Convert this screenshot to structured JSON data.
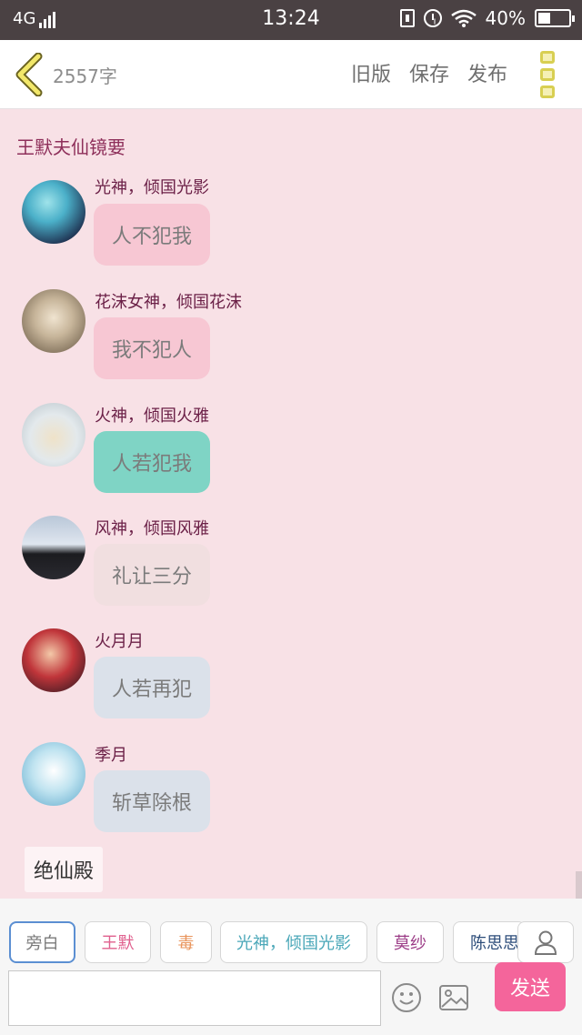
{
  "status_bar": {
    "network": "4G",
    "time": "13:24",
    "battery_text": "40%",
    "battery_level": 0.4
  },
  "header": {
    "word_count": "2557字",
    "old_version": "旧版",
    "save": "保存",
    "publish": "发布"
  },
  "chapter_title": "王默夫仙镜要",
  "messages": [
    {
      "sender": "光神，倾国光影",
      "text": "人不犯我",
      "bubble_color": "#f7c7d3"
    },
    {
      "sender": "花沫女神，倾国花沫",
      "text": "我不犯人",
      "bubble_color": "#f7c7d3"
    },
    {
      "sender": "火神，倾国火雅",
      "text": "人若犯我",
      "bubble_color": "#7fd4c5"
    },
    {
      "sender": "风神，倾国风雅",
      "text": "礼让三分",
      "bubble_color": "#f1dfe0"
    },
    {
      "sender": "火月月",
      "text": "人若再犯",
      "bubble_color": "#dbe1ea"
    },
    {
      "sender": "季月",
      "text": "斩草除根",
      "bubble_color": "#dbe1ea"
    }
  ],
  "narration": "绝仙殿",
  "roles": [
    {
      "label": "旁白",
      "color": "#7a7a7a"
    },
    {
      "label": "王默",
      "color": "#e0608e"
    },
    {
      "label": "毒",
      "color": "#e8935a"
    },
    {
      "label": "光神，倾国光影",
      "color": "#4aa7b8"
    },
    {
      "label": "莫纱",
      "color": "#9b3b86"
    },
    {
      "label": "陈思思",
      "color": "#2d4d7a"
    }
  ],
  "input": {
    "value": "",
    "placeholder": ""
  },
  "send_label": "发送"
}
